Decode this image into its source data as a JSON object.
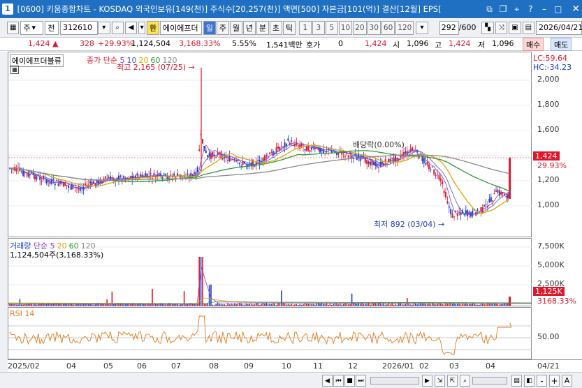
{
  "titlebar": {
    "app_number": "1",
    "title": "[0600] 키움종합차트 - KOSDAQ 외국인보유[149(천)] 주식수[20,257(천)] 액면[500] 자본금[101(억)] 결산[12월] EPS["
  },
  "toolbar": {
    "period_type": "주",
    "market_select": "전",
    "code": "312610",
    "hwan": "환",
    "stock_name": "에이에프더",
    "periods": [
      "일",
      "주",
      "월",
      "년",
      "분",
      "초",
      "틱"
    ],
    "active_period": "일",
    "intervals": [
      "1",
      "3",
      "5",
      "10",
      "20",
      "30",
      "60",
      "120"
    ],
    "count": "292",
    "max": "/600",
    "date": "2026/04/21"
  },
  "info": {
    "price": "1,424",
    "change": "328",
    "change_pct": "+29.93%",
    "volume": "1,124,504",
    "vol_ratio": "3,168.33%",
    "turnover": "5.55%",
    "amount": "1,541백만",
    "hoga_label": "호가",
    "hoga_value": "0",
    "hoga_price": "1,424",
    "open_label": "시",
    "open": "1,096",
    "high_label": "고",
    "high": "1,424",
    "low_label": "저",
    "low": "1,096",
    "buy": "매수",
    "sell": "매도"
  },
  "price_panel": {
    "name": "에이에프더블류",
    "legend_prefix": "종가 단순",
    "ma_periods": [
      "5",
      "10",
      "20",
      "60",
      "120"
    ],
    "ma_colors": [
      "#8b3fbf",
      "#3d5ad8",
      "#e0a800",
      "#2a9a3a",
      "#8a8a8a"
    ],
    "lc": "LC:59.64",
    "hc": "HC:-34.23",
    "yticks": [
      "2,000",
      "1,800",
      "1,600",
      "1,400",
      "1,200",
      "1,000"
    ],
    "cur_price": "1,424",
    "cur_pct": "29.93%",
    "max_label": "최고 2,165 (07/25)",
    "min_label": "최저 892 (03/04)",
    "dividend_label": "배당락(0.00%)"
  },
  "volume_panel": {
    "name": "거래량",
    "legend_prefix": "단순",
    "ma_periods": [
      "5",
      "20",
      "60",
      "120"
    ],
    "ma_colors": [
      "#8b3fbf",
      "#e0a800",
      "#2a9a3a",
      "#8a8a8a"
    ],
    "summary": "1,124,504주(3,168.33%)",
    "yticks": [
      "7,500K",
      "5,000K",
      "2,500K"
    ],
    "cur": "1,125K",
    "cur_pct": "3168.33%"
  },
  "rsi_panel": {
    "name": "RSI 14",
    "ytick": "50.00"
  },
  "xaxis": {
    "labels": [
      "2025/02",
      "04",
      "05",
      "06",
      "07",
      "08",
      "09",
      "10",
      "11",
      "12",
      "2026/01",
      "02",
      "03",
      "04",
      "04/21"
    ]
  },
  "bottom": {
    "zoom_out": "-",
    "zoom_in": "+",
    "all": "A"
  },
  "colors": {
    "up": "#e0162b",
    "down": "#1a3fd0",
    "title_bg": "#1f6fc2"
  }
}
